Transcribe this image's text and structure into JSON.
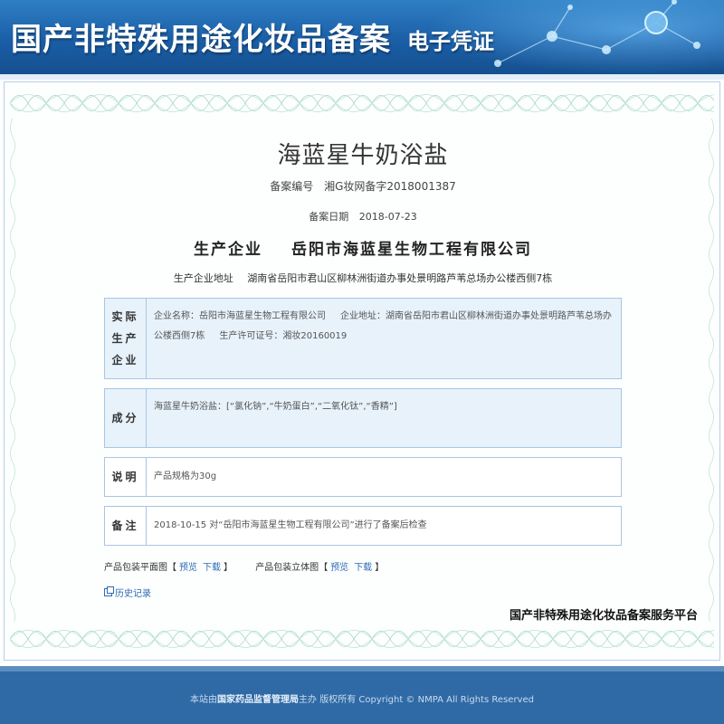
{
  "header": {
    "title": "国产非特殊用途化妆品备案",
    "subtitle": "电子凭证"
  },
  "certificate": {
    "product_name": "海蓝星牛奶浴盐",
    "registration_no_label": "备案编号",
    "registration_no": "湘G妆网备字2018001387",
    "date_label": "备案日期",
    "date": "2018-07-23",
    "manufacturer_label": "生产企业",
    "manufacturer": "岳阳市海蓝星生物工程有限公司",
    "address_label": "生产企业地址",
    "address": "湖南省岳阳市君山区柳林洲街道办事处景明路芦苇总场办公楼西侧7栋"
  },
  "sections": {
    "actual": {
      "label": "实际生产企业",
      "name_text": "企业名称：岳阳市海蓝星生物工程有限公司",
      "address_text": "企业地址：湖南省岳阳市君山区柳林洲街道办事处景明路芦苇总场办公楼西侧7栋",
      "license_text": "生产许可证号：湘妆20160019"
    },
    "ingredients": {
      "label": "成分",
      "text": "海蓝星牛奶浴盐：[“氯化钠”,“牛奶蛋白”,“二氧化钛”,“香精”]"
    },
    "description": {
      "label": "说明",
      "text": "产品规格为30g"
    },
    "remarks": {
      "label": "备注",
      "text": "2018-10-15 对“岳阳市海蓝星生物工程有限公司”进行了备案后检查"
    }
  },
  "downloads": {
    "flat_label": "产品包装平面图",
    "solid_label": "产品包装立体图",
    "bracket_open": "【",
    "bracket_close": "】",
    "preview": "预览",
    "download": "下载"
  },
  "history": {
    "label": "历史记录"
  },
  "platform_name": "国产非特殊用途化妆品备案服务平台",
  "footer": {
    "prefix": "本站由",
    "org": "国家药品监督管理局",
    "suffix": "主办 版权所有 Copyright © NMPA All Rights Reserved"
  },
  "colors": {
    "banner": "#1a5ea6",
    "box_bg": "#e7f2fb",
    "box_border": "#a9c6e2",
    "link": "#2d6bb5",
    "footer": "#2f6aa6"
  },
  "icons": {
    "history": "history-window-icon",
    "molecule": "molecule-decoration-icon"
  }
}
